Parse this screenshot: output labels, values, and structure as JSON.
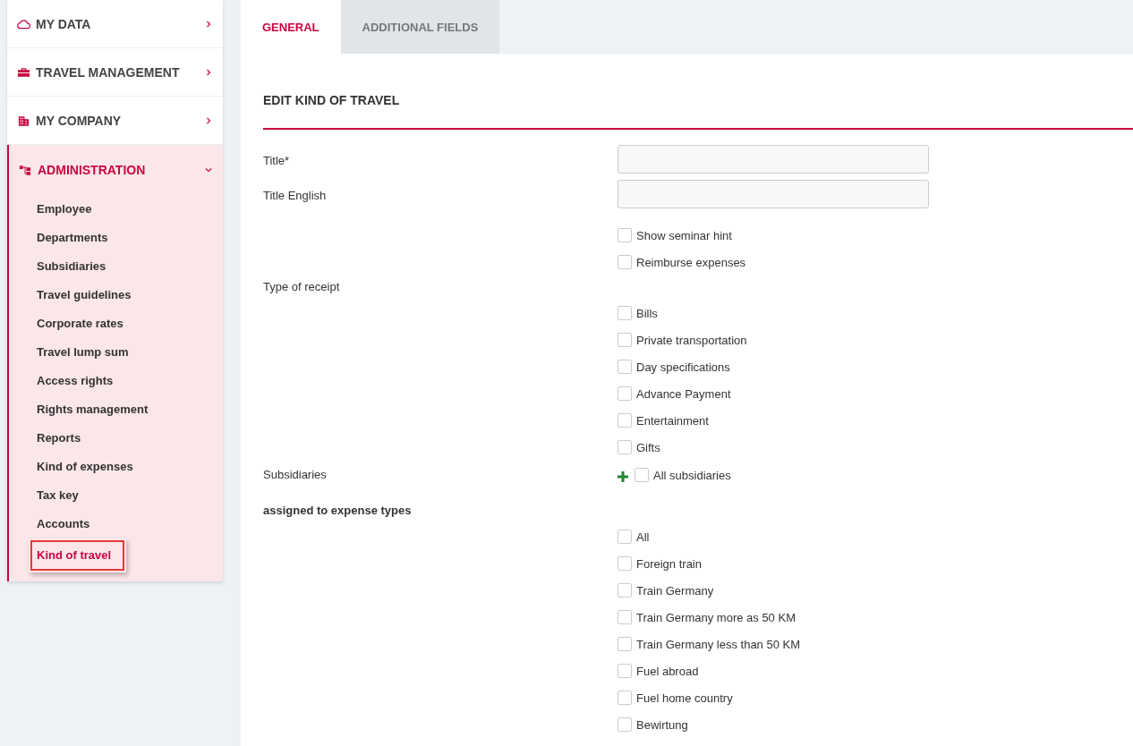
{
  "sidebar": {
    "items": [
      {
        "label": "MY DATA",
        "expanded": false
      },
      {
        "label": "TRAVEL MANAGEMENT",
        "expanded": false
      },
      {
        "label": "MY COMPANY",
        "expanded": false
      },
      {
        "label": "ADMINISTRATION",
        "expanded": true,
        "children": [
          {
            "label": "Employee",
            "selected": false
          },
          {
            "label": "Departments",
            "selected": false
          },
          {
            "label": "Subsidiaries",
            "selected": false
          },
          {
            "label": "Travel guidelines",
            "selected": false
          },
          {
            "label": "Corporate rates",
            "selected": false
          },
          {
            "label": "Travel lump sum",
            "selected": false
          },
          {
            "label": "Access rights",
            "selected": false
          },
          {
            "label": "Rights management",
            "selected": false
          },
          {
            "label": "Reports",
            "selected": false
          },
          {
            "label": "Kind of expenses",
            "selected": false
          },
          {
            "label": "Tax key",
            "selected": false
          },
          {
            "label": "Accounts",
            "selected": false
          },
          {
            "label": "Kind of travel",
            "selected": true
          }
        ]
      }
    ]
  },
  "tabs": [
    {
      "label": "GENERAL",
      "selected": true
    },
    {
      "label": "ADDITIONAL FIELDS",
      "selected": false
    }
  ],
  "form": {
    "title": "EDIT KIND OF TRAVEL",
    "rows": [
      {
        "kind": "input",
        "label": "Title*"
      },
      {
        "kind": "input",
        "label": "Title English"
      },
      {
        "kind": "checkbox",
        "text": "Show seminar hint",
        "checked": false
      },
      {
        "kind": "checkbox",
        "text": "Reimburse expenses",
        "checked": false
      },
      {
        "kind": "heading",
        "label": "Type of receipt",
        "bold": false
      },
      {
        "kind": "checkbox",
        "text": "Bills",
        "checked": false
      },
      {
        "kind": "checkbox",
        "text": "Private transportation",
        "checked": false
      },
      {
        "kind": "checkbox",
        "text": "Day specifications",
        "checked": false
      },
      {
        "kind": "checkbox",
        "text": "Advance Payment",
        "checked": false
      },
      {
        "kind": "checkbox",
        "text": "Entertainment",
        "checked": false
      },
      {
        "kind": "checkbox",
        "text": "Gifts",
        "checked": false
      },
      {
        "kind": "add-checkbox",
        "label": "Subsidiaries",
        "text": "All subsidiaries",
        "checked": false
      },
      {
        "kind": "heading",
        "label": "assigned to expense types",
        "bold": true
      },
      {
        "kind": "checkbox",
        "text": "All",
        "checked": false
      },
      {
        "kind": "checkbox",
        "text": "Foreign train",
        "checked": false
      },
      {
        "kind": "checkbox",
        "text": "Train Germany",
        "checked": false
      },
      {
        "kind": "checkbox",
        "text": "Train Germany more as 50 KM",
        "checked": false
      },
      {
        "kind": "checkbox",
        "text": "Train Germany less than 50 KM",
        "checked": false
      },
      {
        "kind": "checkbox",
        "text": "Fuel abroad",
        "checked": false
      },
      {
        "kind": "checkbox",
        "text": "Fuel home country",
        "checked": false
      },
      {
        "kind": "checkbox",
        "text": "Bewirtung",
        "checked": false
      }
    ]
  }
}
